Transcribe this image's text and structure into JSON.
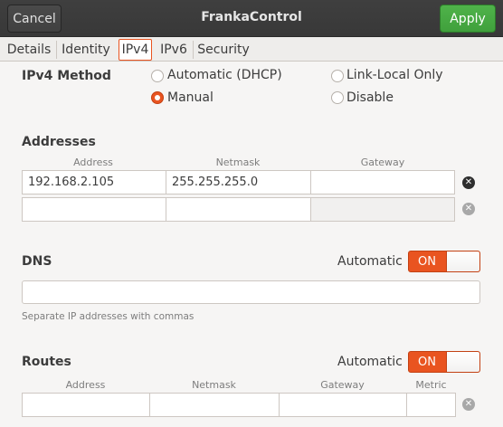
{
  "header": {
    "title": "FrankaControl",
    "cancel_label": "Cancel",
    "apply_label": "Apply"
  },
  "tabs": [
    {
      "label": "Details"
    },
    {
      "label": "Identity"
    },
    {
      "label": "IPv4",
      "active": true
    },
    {
      "label": "IPv6"
    },
    {
      "label": "Security"
    }
  ],
  "ipv4_method": {
    "label": "IPv4 Method",
    "options": [
      {
        "label": "Automatic (DHCP)",
        "selected": false
      },
      {
        "label": "Link-Local Only",
        "selected": false
      },
      {
        "label": "Manual",
        "selected": true
      },
      {
        "label": "Disable",
        "selected": false
      }
    ]
  },
  "addresses": {
    "label": "Addresses",
    "columns": [
      "Address",
      "Netmask",
      "Gateway"
    ],
    "rows": [
      {
        "address": "192.168.2.105",
        "netmask": "255.255.255.0",
        "gateway": ""
      },
      {
        "address": "",
        "netmask": "",
        "gateway": ""
      }
    ]
  },
  "dns": {
    "label": "DNS",
    "automatic_label": "Automatic",
    "switch_label": "ON",
    "value": "",
    "hint": "Separate IP addresses with commas"
  },
  "routes": {
    "label": "Routes",
    "automatic_label": "Automatic",
    "switch_label": "ON",
    "columns": [
      "Address",
      "Netmask",
      "Gateway",
      "Metric"
    ]
  },
  "colors": {
    "accent": "#e95420",
    "apply_green": "#4fb34a",
    "header_bg": "#3c3c3c"
  },
  "icons": {
    "delete": "circle-x-icon"
  }
}
